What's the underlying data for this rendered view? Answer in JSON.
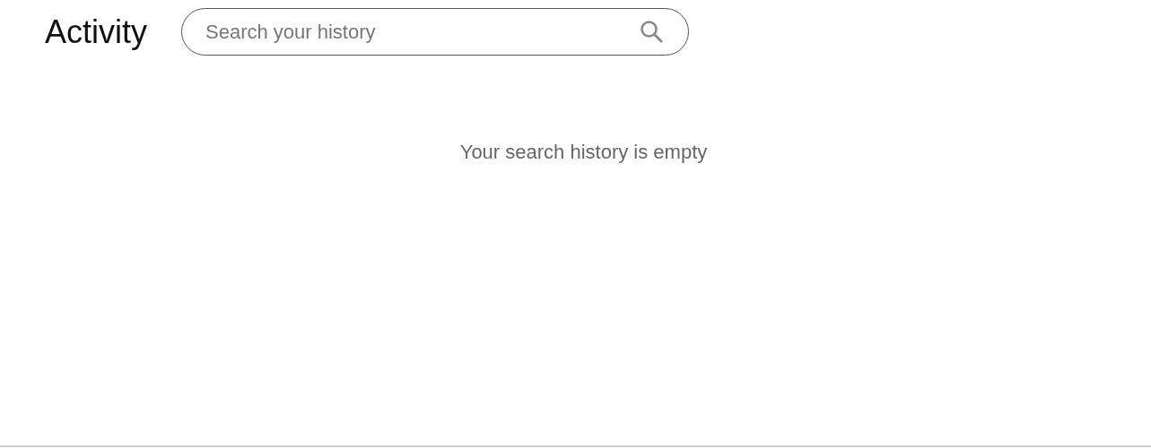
{
  "header": {
    "title": "Activity",
    "search": {
      "placeholder": "Search your history"
    }
  },
  "empty_message": "Your search history is empty"
}
